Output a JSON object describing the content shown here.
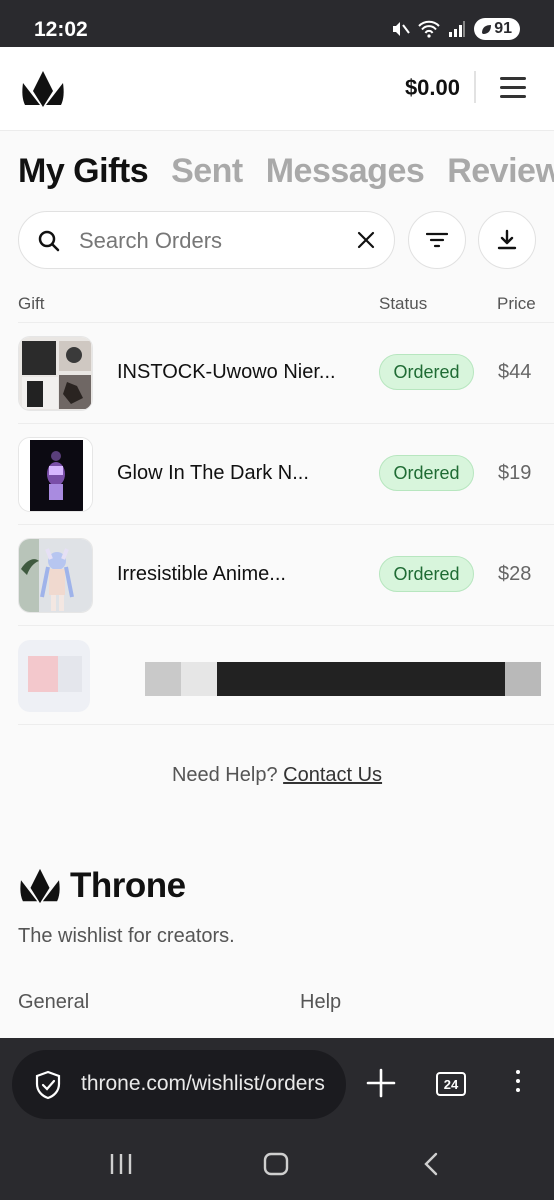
{
  "status_bar": {
    "time": "12:02",
    "battery": "91"
  },
  "header": {
    "balance": "$0.00"
  },
  "tabs": [
    {
      "label": "My Gifts",
      "active": true
    },
    {
      "label": "Sent",
      "active": false
    },
    {
      "label": "Messages",
      "active": false
    },
    {
      "label": "Reviews",
      "active": false
    }
  ],
  "search": {
    "placeholder": "Search Orders"
  },
  "table": {
    "columns": {
      "gift": "Gift",
      "status": "Status",
      "price": "Price"
    },
    "rows": [
      {
        "name": "INSTOCK-Uwowo Nier...",
        "status": "Ordered",
        "price": "$44"
      },
      {
        "name": "Glow In The Dark N...",
        "status": "Ordered",
        "price": "$19"
      },
      {
        "name": "Irresistible Anime...",
        "status": "Ordered",
        "price": "$28"
      }
    ]
  },
  "help": {
    "text": "Need Help?",
    "link": "Contact Us"
  },
  "footer": {
    "brand": "Throne",
    "tagline": "The wishlist for creators.",
    "columns": [
      "General",
      "Help"
    ]
  },
  "browser": {
    "url": "throne.com/wishlist/orders",
    "tab_count": "24"
  },
  "icons": {
    "logo": "crown-icon",
    "menu": "hamburger-menu-icon",
    "search": "search-icon",
    "clear": "close-icon",
    "filter": "filter-icon",
    "download": "download-icon",
    "security": "shield-check-icon",
    "new_tab": "plus-icon",
    "more": "more-vertical-icon",
    "nav_recent": "recent-apps-icon",
    "nav_home": "home-icon",
    "nav_back": "back-icon"
  }
}
